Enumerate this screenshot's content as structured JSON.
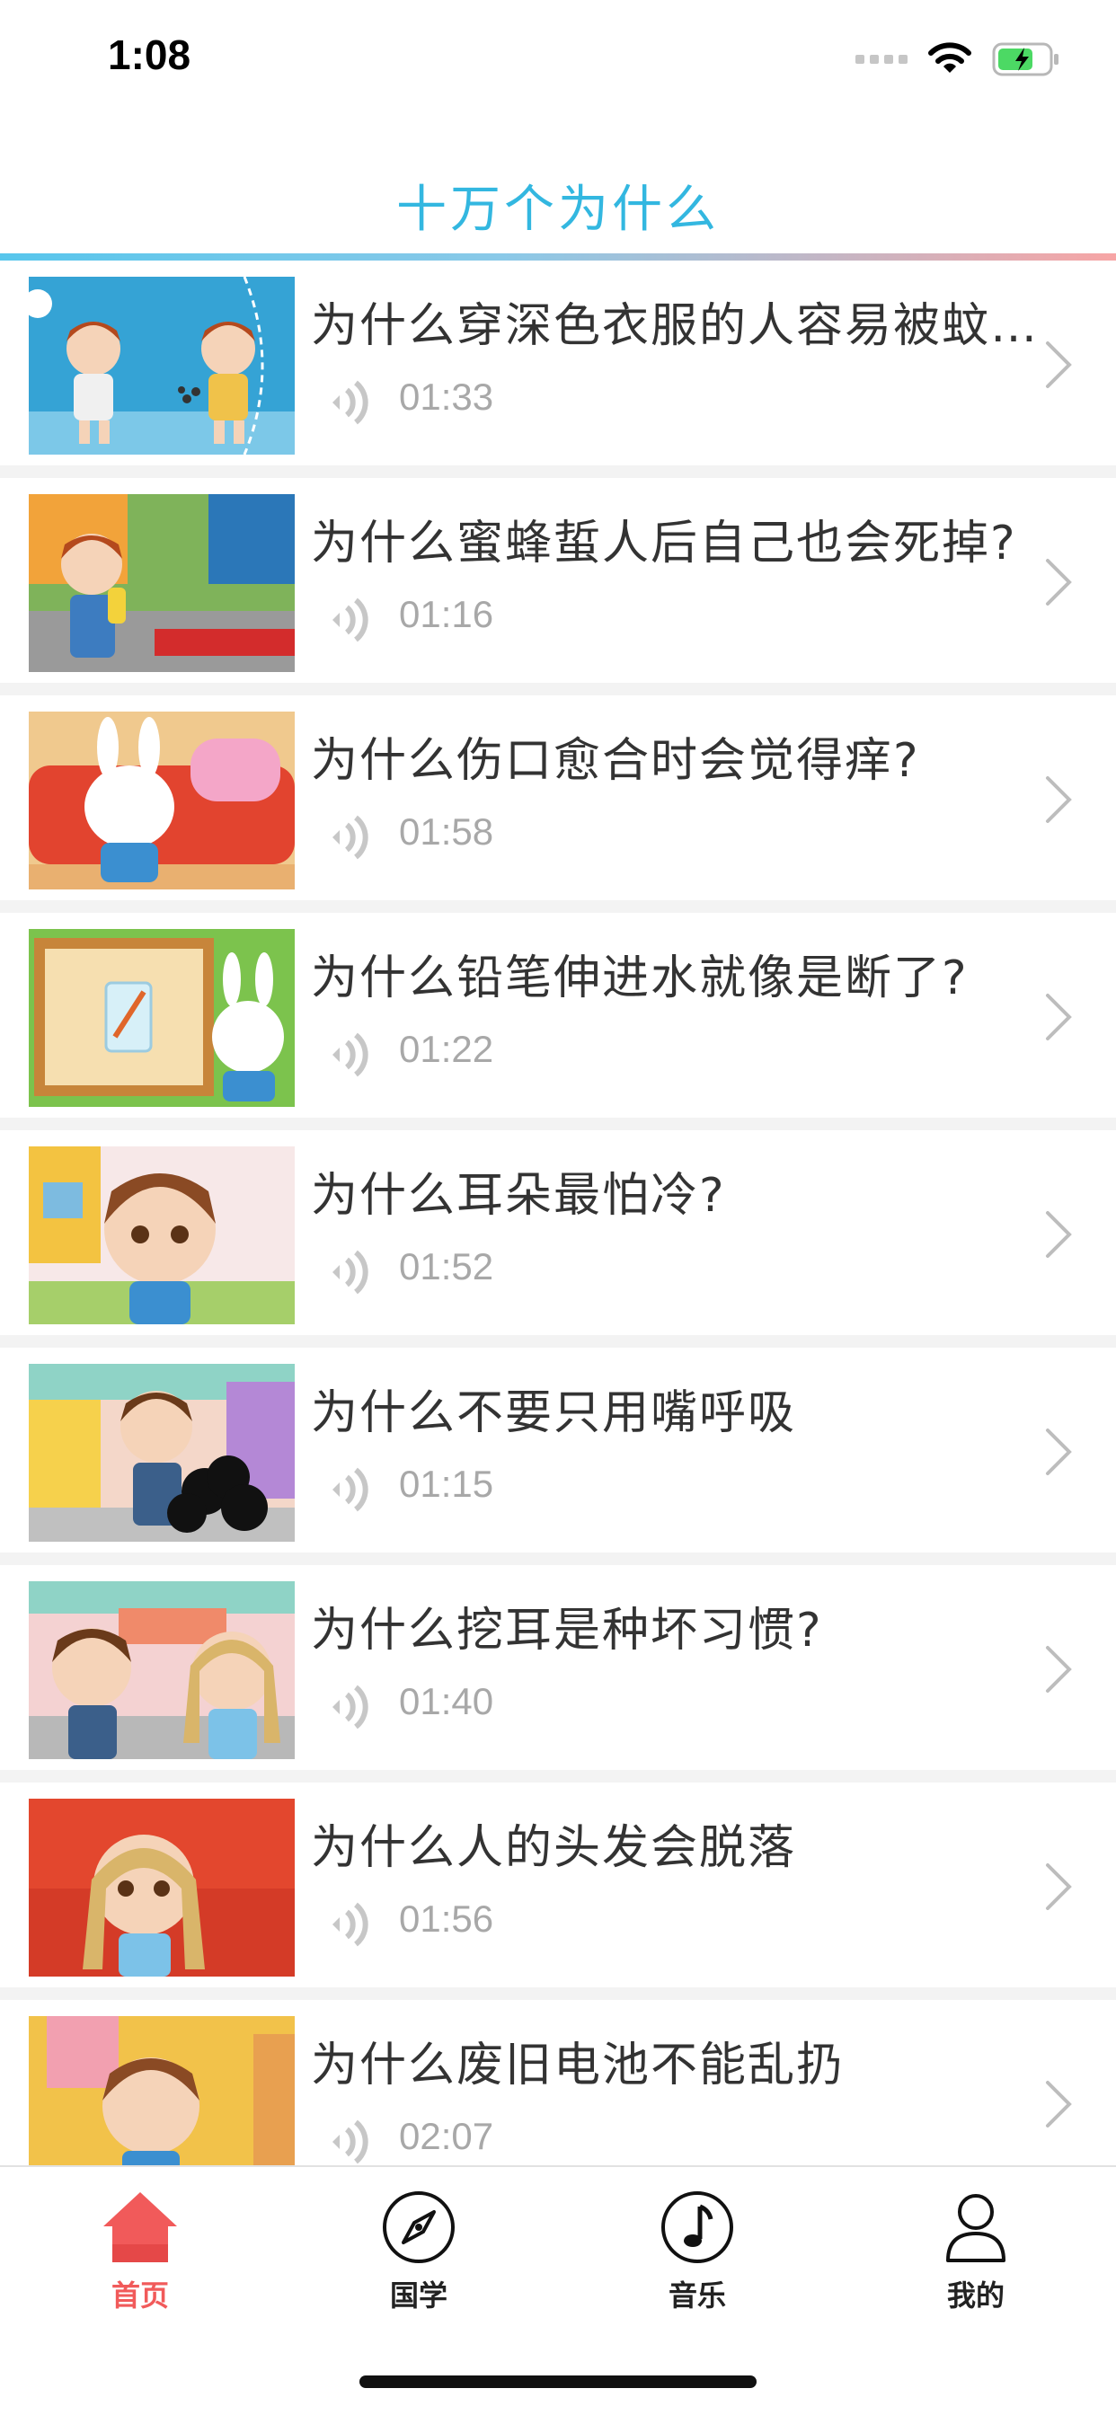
{
  "status": {
    "time": "1:08"
  },
  "nav": {
    "title": "十万个为什么"
  },
  "items": [
    {
      "title": "为什么穿深色衣服的人容易被蚊子咬？",
      "duration": "01:33"
    },
    {
      "title": "为什么蜜蜂蜇人后自己也会死掉?",
      "duration": "01:16"
    },
    {
      "title": "为什么伤口愈合时会觉得痒?",
      "duration": "01:58"
    },
    {
      "title": "为什么铅笔伸进水就像是断了?",
      "duration": "01:22"
    },
    {
      "title": "为什么耳朵最怕冷?",
      "duration": "01:52"
    },
    {
      "title": "为什么不要只用嘴呼吸",
      "duration": "01:15"
    },
    {
      "title": "为什么挖耳是种坏习惯?",
      "duration": "01:40"
    },
    {
      "title": "为什么人的头发会脱落",
      "duration": "01:56"
    },
    {
      "title": "为什么废旧电池不能乱扔",
      "duration": "02:07"
    }
  ],
  "tabs": [
    {
      "label": "首页",
      "icon": "home-icon",
      "active": true
    },
    {
      "label": "国学",
      "icon": "compass-icon",
      "active": false
    },
    {
      "label": "音乐",
      "icon": "music-note-icon",
      "active": false
    },
    {
      "label": "我的",
      "icon": "person-icon",
      "active": false
    }
  ],
  "colors": {
    "accent": "#33b7e0",
    "tab_active": "#f15a5a",
    "title_text": "#333333",
    "duration_text": "#a8a8a8"
  }
}
